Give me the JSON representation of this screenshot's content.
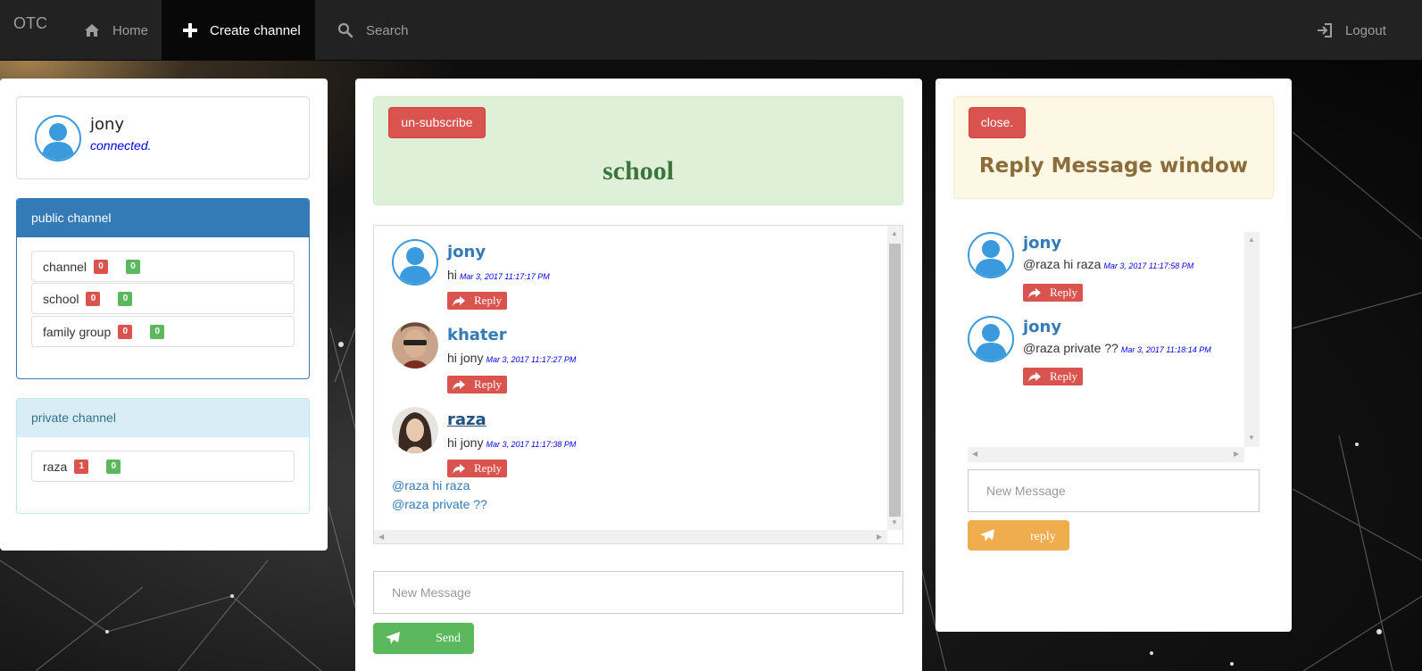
{
  "navbar": {
    "brand": "OTC",
    "home": "Home",
    "create_channel": "Create channel",
    "search": "Search",
    "logout": "Logout"
  },
  "user": {
    "name": "jony",
    "status": "connected."
  },
  "public_channels": {
    "heading": "public channel",
    "items": [
      {
        "name": "channel",
        "red": "0",
        "green": "0"
      },
      {
        "name": "school",
        "red": "0",
        "green": "0"
      },
      {
        "name": "family group",
        "red": "0",
        "green": "0"
      }
    ]
  },
  "private_channels": {
    "heading": "private channel",
    "items": [
      {
        "name": "raza",
        "red": "1",
        "green": "0"
      }
    ]
  },
  "channel": {
    "unsubscribe_label": "un-subscribe",
    "title": "school",
    "messages": [
      {
        "author": "jony",
        "text": "hi",
        "time": "Mar 3, 2017 11:17:17 PM",
        "reply_label": "Reply"
      },
      {
        "author": "khater",
        "text": "hi jony",
        "time": "Mar 3, 2017 11:17:27 PM",
        "reply_label": "Reply"
      },
      {
        "author": "raza",
        "text": "hi jony",
        "time": "Mar 3, 2017 11:17:38 PM",
        "reply_label": "Reply"
      }
    ],
    "mentions": [
      "@raza hi raza",
      "@raza private ??"
    ],
    "input_placeholder": "New Message",
    "send_label": "Send"
  },
  "reply_window": {
    "close_label": "close.",
    "title": "Reply Message window",
    "messages": [
      {
        "author": "jony",
        "text": "@raza hi raza",
        "time": "Mar 3, 2017 11:17:58 PM",
        "reply_label": "Reply"
      },
      {
        "author": "jony",
        "text": "@raza private ??",
        "time": "Mar 3, 2017 11:18:14 PM",
        "reply_label": "Reply"
      }
    ],
    "input_placeholder": "New Message",
    "reply_label": "reply"
  },
  "colors": {
    "primary": "#337ab7",
    "danger": "#d9534f",
    "success": "#5cb85c",
    "warning": "#f0ad4e",
    "info_bg": "#d9edf7"
  },
  "icons": [
    "home-icon",
    "plus-icon",
    "search-icon",
    "logout-icon",
    "share-icon",
    "send-icon",
    "user-avatar-icon"
  ]
}
